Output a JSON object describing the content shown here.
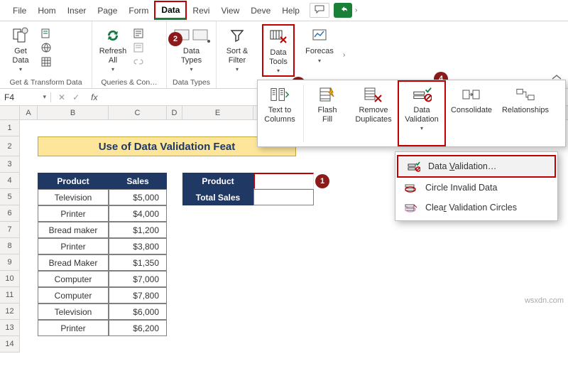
{
  "tabs": {
    "file": "File",
    "home": "Hom",
    "insert": "Inser",
    "page": "Page",
    "form": "Form",
    "data": "Data",
    "review": "Revi",
    "view": "View",
    "dev": "Deve",
    "help": "Help"
  },
  "ribbon": {
    "getdata": "Get\nData",
    "getdata_grp": "Get & Transform Data",
    "refresh": "Refresh\nAll",
    "queries_grp": "Queries & Con…",
    "datatypes": "Data\nTypes",
    "datatypes_grp": "Data Types",
    "sortfilter": "Sort &\nFilter",
    "datatools": "Data\nTools",
    "forecast": "Forecas"
  },
  "popup1": {
    "texttocol": "Text to\nColumns",
    "flashfill": "Flash\nFill",
    "removedup": "Remove\nDuplicates",
    "datavalidation": "Data\nValidation",
    "consolidate": "Consolidate",
    "relationships": "Relationships"
  },
  "popup2": {
    "dv": "Data Validation…",
    "circle": "Circle Invalid Data",
    "clear": "Clear Validation Circles"
  },
  "namebox": "F4",
  "banner": "Use of Data Validation Feat",
  "t1": {
    "h1": "Product",
    "h2": "Sales",
    "rows": [
      {
        "p": "Television",
        "s": "$5,000"
      },
      {
        "p": "Printer",
        "s": "$4,000"
      },
      {
        "p": "Bread maker",
        "s": "$1,200"
      },
      {
        "p": "Printer",
        "s": "$3,800"
      },
      {
        "p": "Bread Maker",
        "s": "$1,350"
      },
      {
        "p": "Computer",
        "s": "$7,000"
      },
      {
        "p": "Computer",
        "s": "$7,800"
      },
      {
        "p": "Television",
        "s": "$6,000"
      },
      {
        "p": "Printer",
        "s": "$6,200"
      }
    ]
  },
  "t2": {
    "h1": "Product",
    "h2": "Total Sales"
  },
  "watermark": "wsxdn.com"
}
